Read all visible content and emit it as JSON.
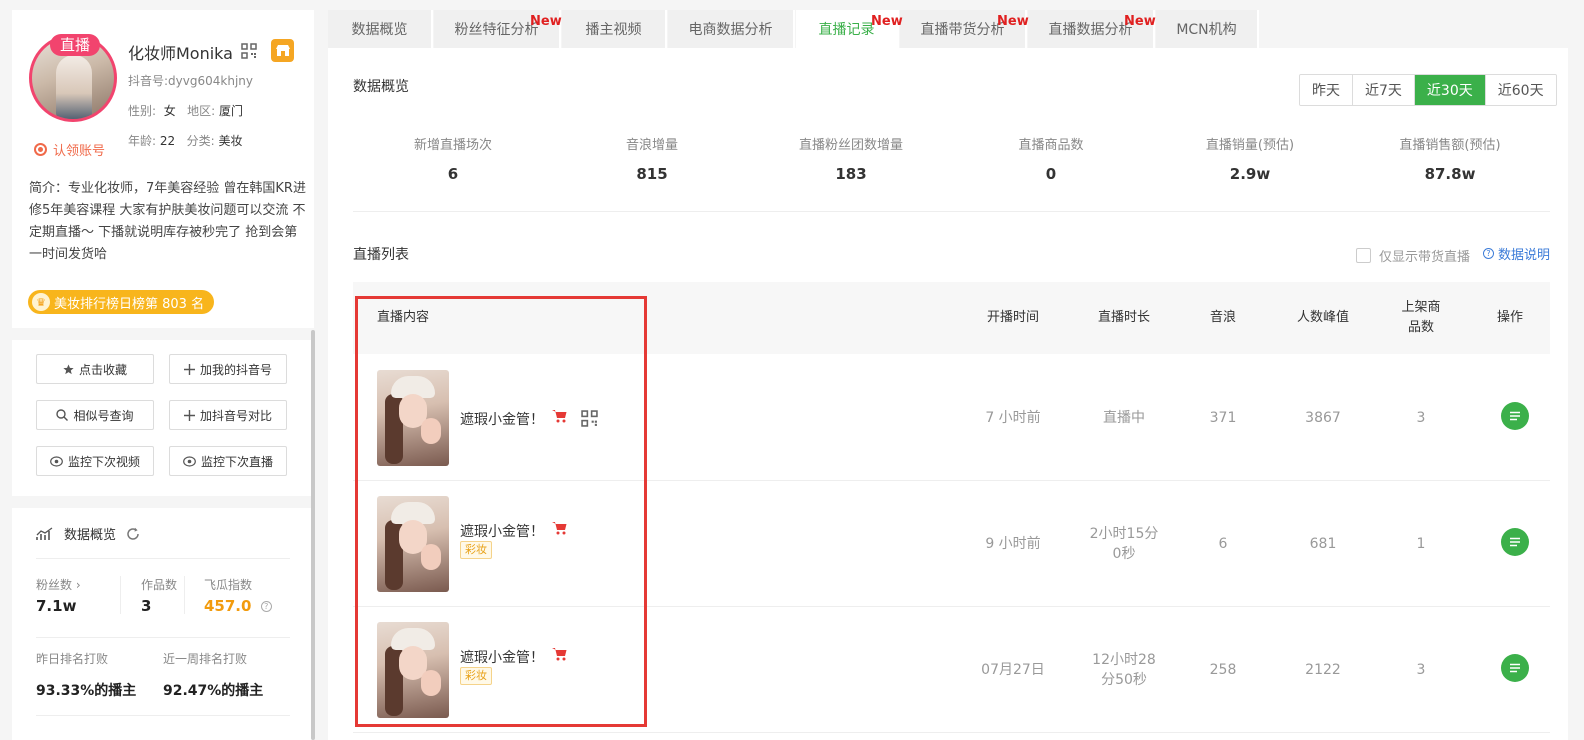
{
  "profile": {
    "live_tag": "直播",
    "nickname": "化妆师Monika",
    "douyin_id_label": "抖音号:",
    "douyin_id": "dyvg604khjny",
    "gender_label": "性别:",
    "gender": "女",
    "region_label": "地区:",
    "region": "厦门",
    "claim": "认领账号",
    "age_label": "年龄:",
    "age": "22",
    "category_label": "分类:",
    "category": "美妆",
    "bio": "简介：专业化妆师，7年美容经验 曾在韩国KR进修5年美容课程 大家有护肤美妆问题可以交流 不定期直播～ 下播就说明库存被秒完了 抢到会第一时间发货哈",
    "rank_badge": "美妆排行榜日榜第 803 名"
  },
  "actions": [
    {
      "label": "点击收藏",
      "icon": "star-icon"
    },
    {
      "label": "加我的抖音号",
      "icon": "plus-icon"
    },
    {
      "label": "相似号查询",
      "icon": "search-icon"
    },
    {
      "label": "加抖音号对比",
      "icon": "plus-icon"
    },
    {
      "label": "监控下次视频",
      "icon": "eye-icon"
    },
    {
      "label": "监控下次直播",
      "icon": "eye-icon"
    }
  ],
  "overview_side": {
    "title": "数据概览",
    "fans_label": "粉丝数",
    "fans": "7.1w",
    "works_label": "作品数",
    "works": "3",
    "feigua_label": "飞瓜指数",
    "feigua": "457.0",
    "yesterday_label": "昨日排名打败",
    "yesterday": "93.33%的播主",
    "week_label": "近一周排名打败",
    "week": "92.47%的播主"
  },
  "tabs": [
    {
      "label": "数据概览",
      "new": ""
    },
    {
      "label": "粉丝特征分析",
      "new": "New"
    },
    {
      "label": "播主视频",
      "new": ""
    },
    {
      "label": "电商数据分析",
      "new": ""
    },
    {
      "label": "直播记录",
      "new": "New"
    },
    {
      "label": "直播带货分析",
      "new": "New"
    },
    {
      "label": "直播数据分析",
      "new": "New"
    },
    {
      "label": "MCN机构",
      "new": ""
    }
  ],
  "main": {
    "overview_title": "数据概览",
    "periods": [
      "昨天",
      "近7天",
      "近30天",
      "近60天"
    ],
    "active_period": "近30天",
    "stats": [
      {
        "label": "新增直播场次",
        "value": "6"
      },
      {
        "label": "音浪增量",
        "value": "815"
      },
      {
        "label": "直播粉丝团数增量",
        "value": "183"
      },
      {
        "label": "直播商品数",
        "value": "0"
      },
      {
        "label": "直播销量(预估)",
        "value": "2.9w"
      },
      {
        "label": "直播销售额(预估)",
        "value": "87.8w"
      }
    ],
    "list_title": "直播列表",
    "only_selling": "仅显示带货直播",
    "help": "数据说明"
  },
  "table": {
    "headers": {
      "content": "直播内容",
      "start": "开播时间",
      "duration": "直播时长",
      "sound": "音浪",
      "peak": "人数峰值",
      "goods": "上架商品数",
      "op": "操作"
    },
    "rows": [
      {
        "title": "遮瑕小金管！",
        "tag": "",
        "start": "7 小时前",
        "duration": "直播中",
        "sound": "371",
        "peak": "3867",
        "goods": "3"
      },
      {
        "title": "遮瑕小金管！",
        "tag": "彩妆",
        "start": "9 小时前",
        "duration": "2小时15分0秒",
        "sound": "6",
        "peak": "681",
        "goods": "1"
      },
      {
        "title": "遮瑕小金管！",
        "tag": "彩妆",
        "start": "07月27日",
        "duration": "12小时28分50秒",
        "sound": "258",
        "peak": "2122",
        "goods": "3"
      }
    ]
  },
  "colors": {
    "accent": "#3bb04a",
    "live": "#f2446e",
    "new": "#e02020",
    "highlight": "#e53935",
    "orange": "#f29b0d"
  }
}
